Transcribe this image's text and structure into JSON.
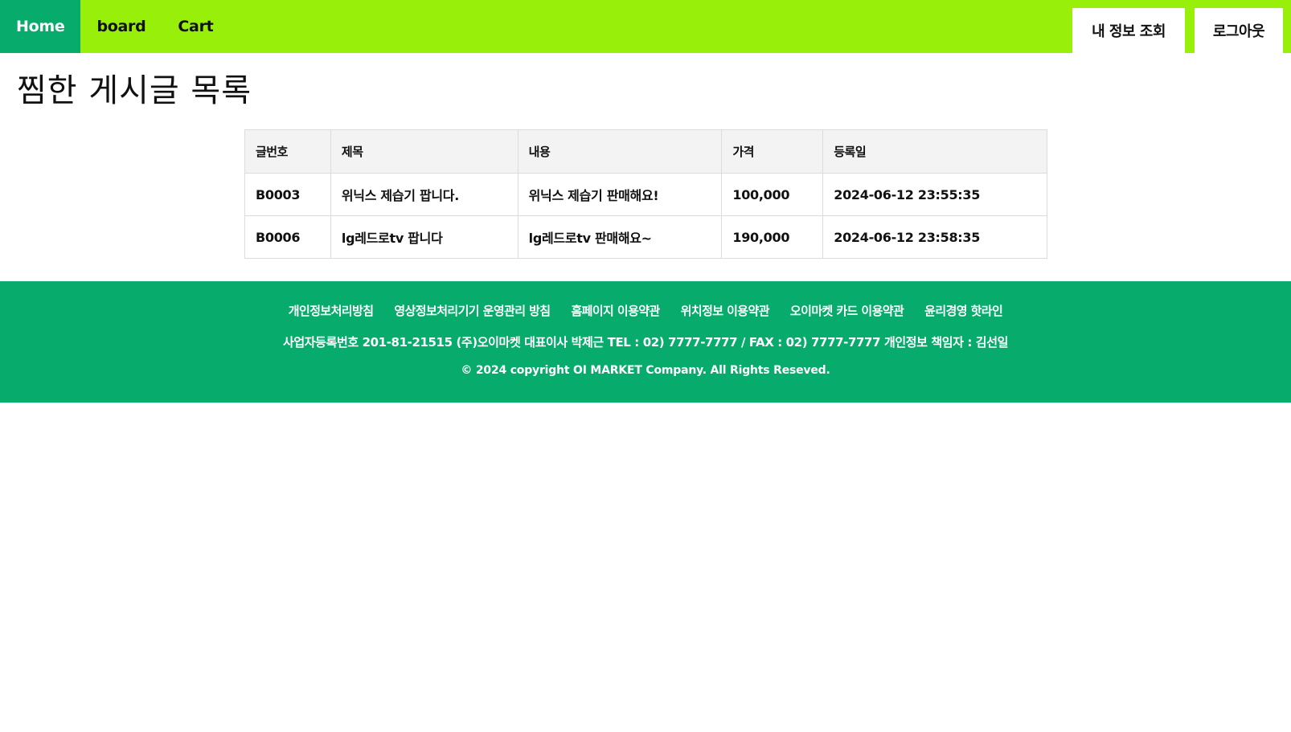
{
  "nav": {
    "items": [
      {
        "label": "Home",
        "active": true
      },
      {
        "label": "board",
        "active": false
      },
      {
        "label": "Cart",
        "active": false
      }
    ],
    "my_info_label": "내 정보 조회",
    "logout_label": "로그아웃"
  },
  "page": {
    "title": "찜한 게시글 목록"
  },
  "table": {
    "headers": [
      "글번호",
      "제목",
      "내용",
      "가격",
      "등록일"
    ],
    "rows": [
      {
        "no": "B0003",
        "title": "위닉스 제습기 팝니다.",
        "content": "위닉스 제습기 판매해요!",
        "price": "100,000",
        "date": "2024-06-12 23:55:35"
      },
      {
        "no": "B0006",
        "title": "lg레드로tv 팝니다",
        "content": "lg레드로tv 판매해요~",
        "price": "190,000",
        "date": "2024-06-12 23:58:35"
      }
    ]
  },
  "footer": {
    "links": [
      "개인정보처리방침",
      "영상정보처리기기 운영관리 방침",
      "홈페이지 이용약관",
      "위치정보 이용약관",
      "오이마켓 카드 이용약관",
      "윤리경영 핫라인"
    ],
    "info": "사업자등록번호 201-81-21515 (주)오이마켓 대표이사 박제근 TEL : 02) 7777-7777 / FAX : 02) 7777-7777 개인정보 책임자 : 김선일",
    "copyright": "© 2024 copyright OI MARKET Company. All Rights Reseved."
  },
  "colors": {
    "nav_bg": "#97EF0A",
    "nav_active_bg": "#07AB6B",
    "footer_bg": "#07AB6B",
    "table_header_bg": "#f3f3f3"
  }
}
